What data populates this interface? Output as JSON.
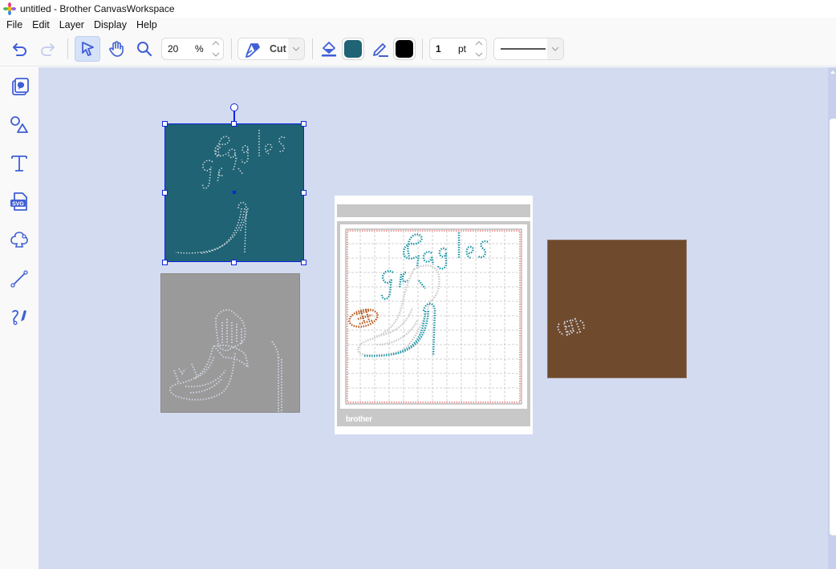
{
  "window": {
    "title": "untitled - Brother CanvasWorkspace"
  },
  "menu": [
    "File",
    "Edit",
    "Layer",
    "Display",
    "Help"
  ],
  "toolbar": {
    "undo_icon": "undo-icon",
    "redo_icon": "redo-icon",
    "select_tool_icon": "pointer-icon",
    "pan_tool_icon": "hand-icon",
    "zoom_tool_icon": "magnifier-icon",
    "zoom_value": "20",
    "zoom_unit": "%",
    "mode_label": "Cut",
    "fill_color": "#1f6374",
    "stroke_color": "#000000",
    "stroke_width": "1",
    "stroke_unit": "pt",
    "line_style": "solid"
  },
  "sidebar": {
    "items": [
      {
        "name": "templates",
        "icon": "templates-icon"
      },
      {
        "name": "shapes",
        "icon": "shapes-icon"
      },
      {
        "name": "text",
        "icon": "text-icon"
      },
      {
        "name": "svg-import",
        "icon": "svg-file-icon",
        "label": "SVG"
      },
      {
        "name": "outline",
        "icon": "outline-shape-icon"
      },
      {
        "name": "line",
        "icon": "line-icon"
      },
      {
        "name": "freehand",
        "icon": "freehand-icon"
      }
    ]
  },
  "canvas": {
    "background_color": "#d3dbf0",
    "objects": [
      {
        "name": "eagles-girl-teal-layer",
        "fill": "#1f6374",
        "selected": true,
        "text": "Eagles girl"
      },
      {
        "name": "shoe-gray-layer",
        "fill": "#9a9a9a",
        "selected": false
      },
      {
        "name": "mat-preview",
        "fill": "#ffffff",
        "text": "Eagles girl",
        "brand": "brother"
      },
      {
        "name": "football-brown-layer",
        "fill": "#6f4a2d",
        "selected": false
      }
    ],
    "colors": {
      "teal_rhinestone": "#1c95a6",
      "orange_rhinestone": "#b5561b",
      "gray_rhinestone": "#c9c9c9",
      "selection": "#0f24e0"
    }
  }
}
